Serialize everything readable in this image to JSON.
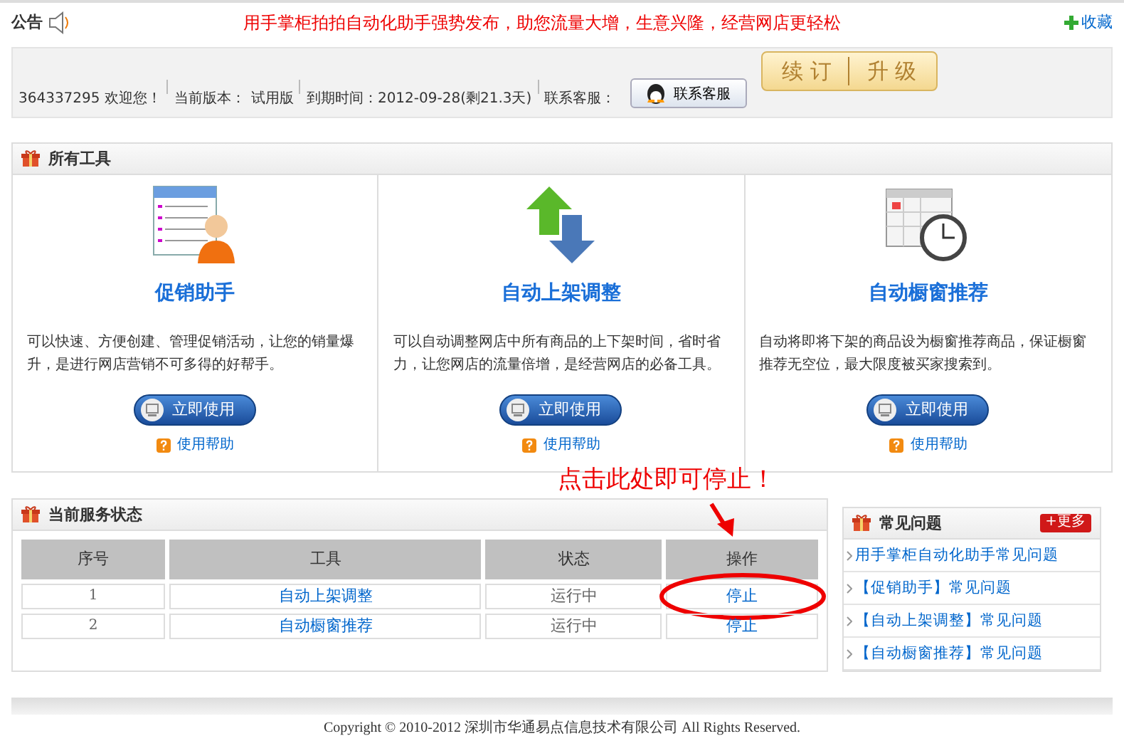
{
  "notice": {
    "label": "公告",
    "message": "用手掌柜拍拍自动化助手强势发布，助您流量大增，生意兴隆，经营网店更轻松",
    "collapse": "收藏"
  },
  "account": {
    "user": "364337295 欢迎您！",
    "version_label": "当前版本：",
    "version": "试用版",
    "expiry": "到期时间：2012-09-28(剩21.3天)",
    "support_label": "联系客服：",
    "support_button": "联系客服",
    "upgrade_button": [
      "续 订",
      "升 级"
    ]
  },
  "tools": {
    "title": "所有工具",
    "items": [
      {
        "kind": "promo",
        "name": "促销助手",
        "description": "可以快速、方便创建、管理促销活动，让您的销量爆升，是进行网店营销不可多得的好帮手。",
        "use": "立即使用",
        "help": "使用帮助"
      },
      {
        "kind": "shelf",
        "name": "自动上架调整",
        "description": "可以自动调整网店中所有商品的上下架时间，省时省力，让您网店的流量倍增，是经营网店的必备工具。",
        "use": "立即使用",
        "help": "使用帮助"
      },
      {
        "kind": "window",
        "name": "自动橱窗推荐",
        "description": "自动将即将下架的商品设为橱窗推荐商品，保证橱窗推荐无空位，最大限度被买家搜索到。",
        "use": "立即使用",
        "help": "使用帮助"
      }
    ]
  },
  "annotation": "点击此处即可停止！",
  "service_status": {
    "title": "当前服务状态",
    "columns": [
      "序号",
      "工具",
      "状态",
      "操作"
    ],
    "rows": [
      {
        "index": "1",
        "tool": "自动上架调整",
        "status": "运行中",
        "action": "停止",
        "circled": true
      },
      {
        "index": "2",
        "tool": "自动橱窗推荐",
        "status": "运行中",
        "action": "停止",
        "circled": false
      }
    ]
  },
  "faq": {
    "title": "常见问题",
    "more": "+更多",
    "items": [
      "用手掌柜自动化助手常见问题",
      "【促销助手】常见问题",
      "【自动上架调整】常见问题",
      "【自动橱窗推荐】常见问题"
    ]
  },
  "footer": "Copyright © 2010-2012 深圳市华通易点信息技术有限公司  All Rights Reserved."
}
